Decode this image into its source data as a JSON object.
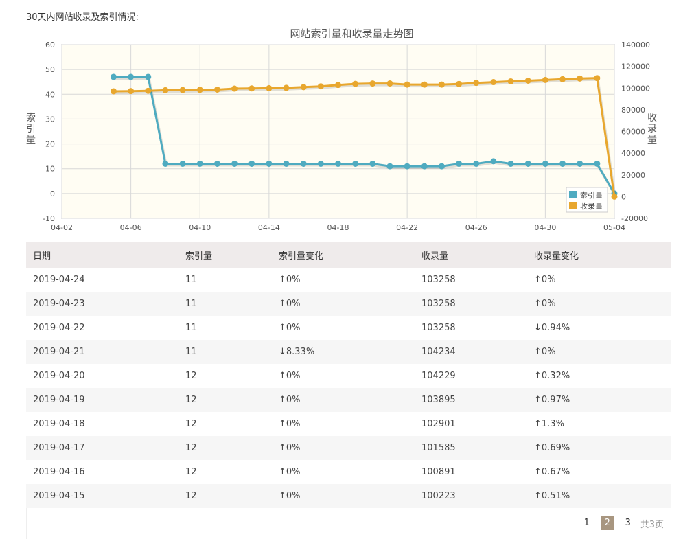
{
  "page": {
    "heading": "30天内网站收录及索引情况:"
  },
  "chart_data": {
    "type": "line",
    "title": "网站索引量和收录量走势图",
    "ylabel_left": "索引量",
    "ylabel_right": "收录量",
    "xlim": [
      "04-02",
      "05-04"
    ],
    "ylim_left": [
      -10,
      60
    ],
    "ylim_right": [
      -20000,
      140000
    ],
    "x_ticks": [
      "04-02",
      "04-06",
      "04-10",
      "04-14",
      "04-18",
      "04-22",
      "04-26",
      "04-30",
      "05-04"
    ],
    "y_ticks_left": [
      "-10",
      "0",
      "10",
      "20",
      "30",
      "40",
      "50",
      "60"
    ],
    "y_ticks_right": [
      "-20000",
      "0",
      "20000",
      "40000",
      "60000",
      "80000",
      "100000",
      "120000",
      "140000"
    ],
    "grid": true,
    "legend_position": "bottom-right",
    "x": [
      "04-05",
      "04-06",
      "04-07",
      "04-08",
      "04-09",
      "04-10",
      "04-11",
      "04-12",
      "04-13",
      "04-14",
      "04-15",
      "04-16",
      "04-17",
      "04-18",
      "04-19",
      "04-20",
      "04-21",
      "04-22",
      "04-23",
      "04-24",
      "04-25",
      "04-26",
      "04-27",
      "04-28",
      "04-29",
      "04-30",
      "05-01",
      "05-02",
      "05-03",
      "05-04"
    ],
    "series": [
      {
        "name": "索引量",
        "axis": "left",
        "color": "#4fabc0",
        "values": [
          47,
          47,
          47,
          12,
          12,
          12,
          12,
          12,
          12,
          12,
          12,
          12,
          12,
          12,
          12,
          12,
          11,
          11,
          11,
          11,
          12,
          12,
          13,
          12,
          12,
          12,
          12,
          12,
          12,
          0
        ]
      },
      {
        "name": "收录量",
        "axis": "right",
        "color": "#e8a72e",
        "values": [
          97000,
          97200,
          97500,
          98000,
          98200,
          98400,
          98600,
          99500,
          99700,
          99900,
          100223,
          100891,
          101585,
          102901,
          103895,
          104229,
          104234,
          103258,
          103258,
          103258,
          103800,
          104800,
          105500,
          106200,
          106800,
          107500,
          108200,
          108800,
          109200,
          0
        ]
      }
    ]
  },
  "table": {
    "headers": [
      "日期",
      "索引量",
      "索引量变化",
      "收录量",
      "收录量变化"
    ],
    "rows": [
      {
        "date": "2019-04-24",
        "index": "11",
        "index_change": "↑0%",
        "index_dir": "up",
        "record": "103258",
        "record_change": "↑0%",
        "record_dir": "up"
      },
      {
        "date": "2019-04-23",
        "index": "11",
        "index_change": "↑0%",
        "index_dir": "up",
        "record": "103258",
        "record_change": "↑0%",
        "record_dir": "up"
      },
      {
        "date": "2019-04-22",
        "index": "11",
        "index_change": "↑0%",
        "index_dir": "up",
        "record": "103258",
        "record_change": "↓0.94%",
        "record_dir": "down"
      },
      {
        "date": "2019-04-21",
        "index": "11",
        "index_change": "↓8.33%",
        "index_dir": "down",
        "record": "104234",
        "record_change": "↑0%",
        "record_dir": "up"
      },
      {
        "date": "2019-04-20",
        "index": "12",
        "index_change": "↑0%",
        "index_dir": "up",
        "record": "104229",
        "record_change": "↑0.32%",
        "record_dir": "up"
      },
      {
        "date": "2019-04-19",
        "index": "12",
        "index_change": "↑0%",
        "index_dir": "up",
        "record": "103895",
        "record_change": "↑0.97%",
        "record_dir": "up"
      },
      {
        "date": "2019-04-18",
        "index": "12",
        "index_change": "↑0%",
        "index_dir": "up",
        "record": "102901",
        "record_change": "↑1.3%",
        "record_dir": "up"
      },
      {
        "date": "2019-04-17",
        "index": "12",
        "index_change": "↑0%",
        "index_dir": "up",
        "record": "101585",
        "record_change": "↑0.69%",
        "record_dir": "up"
      },
      {
        "date": "2019-04-16",
        "index": "12",
        "index_change": "↑0%",
        "index_dir": "up",
        "record": "100891",
        "record_change": "↑0.67%",
        "record_dir": "up"
      },
      {
        "date": "2019-04-15",
        "index": "12",
        "index_change": "↑0%",
        "index_dir": "up",
        "record": "100223",
        "record_change": "↑0.51%",
        "record_dir": "up"
      }
    ]
  },
  "pagination": {
    "pages": [
      "1",
      "2",
      "3"
    ],
    "current": "2",
    "total": "共3页"
  }
}
